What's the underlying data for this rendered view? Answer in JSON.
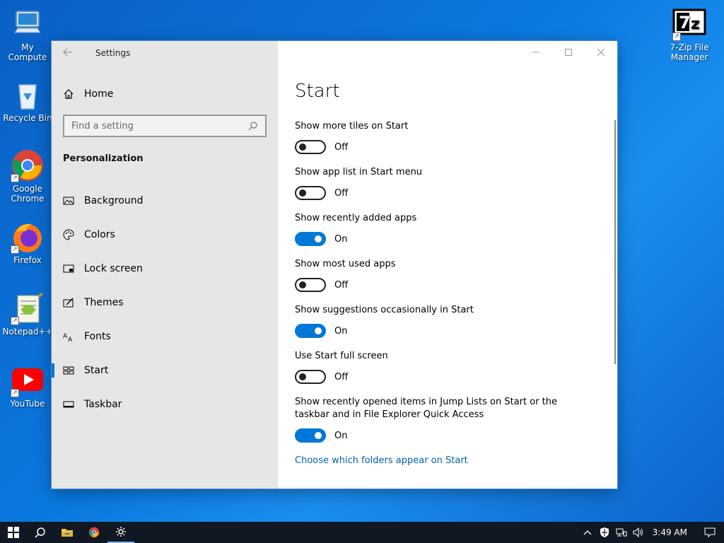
{
  "desktop": {
    "icons": [
      {
        "label": "My Compute",
        "icon": "computer-icon"
      },
      {
        "label": "Recycle Bin",
        "icon": "recycle-bin-icon"
      },
      {
        "label": "Google Chrome",
        "icon": "chrome-icon"
      },
      {
        "label": "Firefox",
        "icon": "firefox-icon"
      },
      {
        "label": "Notepad++",
        "icon": "notepad-plus-plus-icon"
      },
      {
        "label": "YouTube",
        "icon": "youtube-icon"
      },
      {
        "label": "7-Zip File Manager",
        "icon": "7zip-icon"
      }
    ]
  },
  "window": {
    "title": "Settings",
    "controls": [
      "minimize",
      "maximize",
      "close"
    ]
  },
  "sidebar": {
    "home_label": "Home",
    "search_placeholder": "Find a setting",
    "section_title": "Personalization",
    "items": [
      {
        "label": "Background",
        "icon": "background-icon",
        "active": false
      },
      {
        "label": "Colors",
        "icon": "palette-icon",
        "active": false
      },
      {
        "label": "Lock screen",
        "icon": "lock-screen-icon",
        "active": false
      },
      {
        "label": "Themes",
        "icon": "themes-icon",
        "active": false
      },
      {
        "label": "Fonts",
        "icon": "fonts-icon",
        "active": false
      },
      {
        "label": "Start",
        "icon": "start-icon",
        "active": true
      },
      {
        "label": "Taskbar",
        "icon": "taskbar-icon",
        "active": false
      }
    ]
  },
  "main": {
    "page_title": "Start",
    "settings": [
      {
        "label": "Show more tiles on Start",
        "state": "Off"
      },
      {
        "label": "Show app list in Start menu",
        "state": "Off"
      },
      {
        "label": "Show recently added apps",
        "state": "On"
      },
      {
        "label": "Show most used apps",
        "state": "Off"
      },
      {
        "label": "Show suggestions occasionally in Start",
        "state": "On"
      },
      {
        "label": "Use Start full screen",
        "state": "Off"
      },
      {
        "label": "Show recently opened items in Jump Lists on Start or the taskbar and in File Explorer Quick Access",
        "state": "On"
      }
    ],
    "link": "Choose which folders appear on Start"
  },
  "taskbar": {
    "clock": "3:49 AM"
  },
  "colors": {
    "accent": "#0078d7",
    "link": "#0063b1",
    "sidebar_bg": "#e6e6e6",
    "taskbar_bg": "#101823"
  }
}
